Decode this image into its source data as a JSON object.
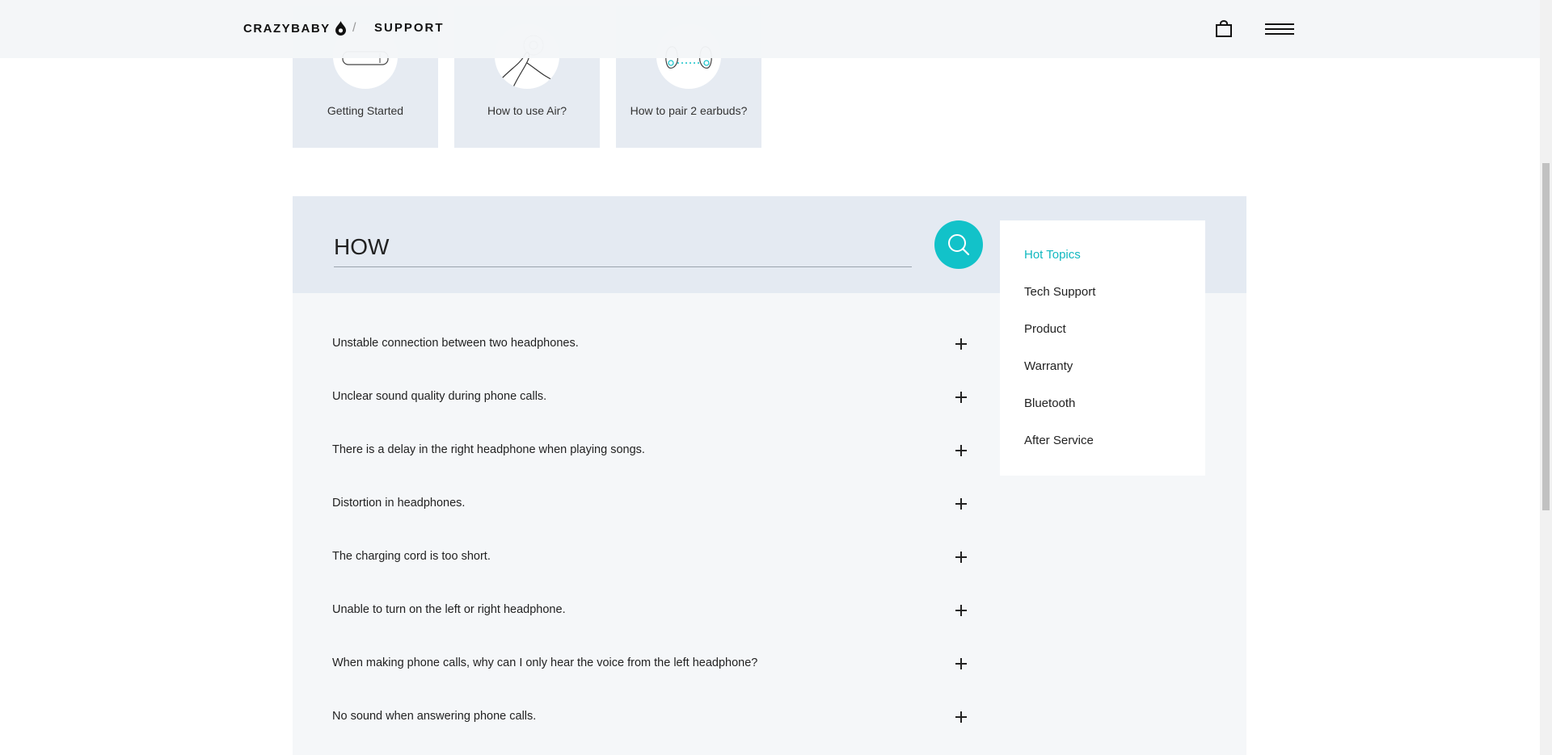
{
  "header": {
    "brand": "CRAZYBABY",
    "separator": "/",
    "section": "SUPPORT",
    "cart_icon": "shopping-bag-icon",
    "menu_icon": "hamburger-menu-icon"
  },
  "cards": [
    {
      "label": "Getting Started",
      "icon": "earbud-case-icon"
    },
    {
      "label": "How to use Air?",
      "icon": "hand-earbud-icon"
    },
    {
      "label": "How to pair 2 earbuds?",
      "icon": "pair-earbuds-icon"
    }
  ],
  "search": {
    "value": "HOW",
    "button_icon": "search-icon"
  },
  "faq": [
    "Unstable connection between two headphones.",
    "Unclear sound quality during phone calls.",
    "There is a delay in the right headphone when playing songs.",
    "Distortion in headphones.",
    "The charging cord is too short.",
    "Unable to turn on the left or right headphone.",
    "When making phone calls, why can I only hear the voice from the left headphone?",
    "No sound when answering phone calls."
  ],
  "categories": {
    "active": "Hot Topics",
    "items": [
      "Hot Topics",
      "Tech Support",
      "Product",
      "Warranty",
      "Bluetooth",
      "After Service"
    ]
  },
  "colors": {
    "accent": "#12c2c9",
    "panel": "#e4eaf2",
    "card": "#e6ebf2"
  }
}
